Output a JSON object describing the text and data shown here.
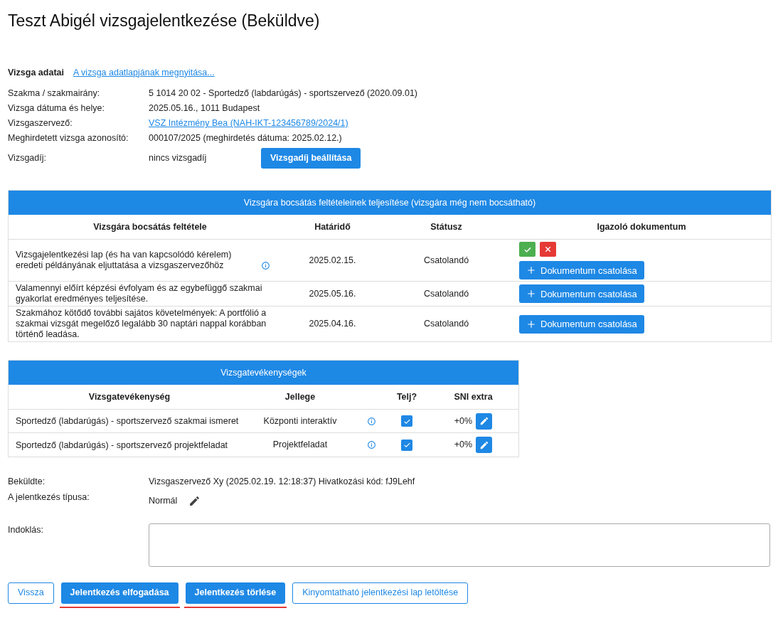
{
  "title": "Teszt Abigél vizsgajelentkezése (Beküldve)",
  "exam": {
    "heading": "Vizsga adatai",
    "link": "A vizsga adatlapjának megnyitása...",
    "fields": [
      {
        "label": "Szakma / szakmairány:",
        "value": "5 1014 20 02 - Sportedző (labdarúgás) - sportszervező (2020.09.01)",
        "kind": "text"
      },
      {
        "label": "Vizsga dátuma és helye:",
        "value": "2025.05.16., 1011 Budapest",
        "kind": "text"
      },
      {
        "label": "Vizsgaszervező:",
        "value": "VSZ Intézmény Bea (NAH-IKT-123456789/2024/1)",
        "kind": "link"
      },
      {
        "label": "Meghirdetett vizsga azonosító:",
        "value": "000107/2025 (meghirdetés dátuma: 2025.02.12.)",
        "kind": "text"
      },
      {
        "label": "Vizsgadíj:",
        "value": "nincs vizsgadíj",
        "kind": "button",
        "button": "Vizsgadíj beállítása"
      }
    ]
  },
  "conditions": {
    "title": "Vizsgára bocsátás feltételeinek teljesítése (vizsgára még nem bocsátható)",
    "columns": [
      "Vizsgára bocsátás feltétele",
      "Határidő",
      "Státusz",
      "Igazoló dokumentum"
    ],
    "rows": [
      {
        "condition": "Vizsgajelentkezési lap (és ha van kapcsolódó kérelem) eredeti példányának eljuttatása a vizsgaszervezőhöz",
        "info": true,
        "deadline": "2025.02.15.",
        "status": "Csatolandó",
        "review_buttons": true,
        "attach": "Dokumentum csatolása"
      },
      {
        "condition": "Valamennyi előírt képzési évfolyam és az egybefüggő szakmai gyakorlat eredményes teljesítése.",
        "info": false,
        "deadline": "2025.05.16.",
        "status": "Csatolandó",
        "review_buttons": false,
        "attach": "Dokumentum csatolása"
      },
      {
        "condition": "Szakmához kötődő további sajátos követelmények: A portfólió a szakmai vizsgát megelőző legalább 30 naptári nappal korábban történő leadása.",
        "info": false,
        "deadline": "2025.04.16.",
        "status": "Csatolandó",
        "review_buttons": false,
        "attach": "Dokumentum csatolása"
      }
    ]
  },
  "activities": {
    "title": "Vizsgatevékenységek",
    "columns": [
      "Vizsgatevékenység",
      "Jellege",
      "Telj?",
      "SNI extra"
    ],
    "rows": [
      {
        "name": "Sportedző (labdarúgás) - sportszervező szakmai ismeret",
        "type": "Központi interaktív",
        "checked": true,
        "extra": "+0%"
      },
      {
        "name": "Sportedző (labdarúgás) - sportszervező projektfeladat",
        "type": "Projektfeladat",
        "checked": true,
        "extra": "+0%"
      }
    ]
  },
  "submitted": {
    "label": "Beküldte:",
    "value": "Vizsgaszervező Xy (2025.02.19. 12:18:37) Hivatkozási kód: fJ9Lehf"
  },
  "application_type": {
    "label": "A jelentkezés típusa:",
    "value": "Normál"
  },
  "justification": {
    "label": "Indoklás:"
  },
  "buttons": [
    {
      "label": "Vissza",
      "kind": "secondary",
      "highlighted": false
    },
    {
      "label": "Jelentkezés elfogadása",
      "kind": "primary",
      "highlighted": true
    },
    {
      "label": "Jelentkezés törlése",
      "kind": "primary",
      "highlighted": true
    },
    {
      "label": "Kinyomtatható jelentkezési lap letöltése",
      "kind": "secondary",
      "highlighted": false
    }
  ]
}
